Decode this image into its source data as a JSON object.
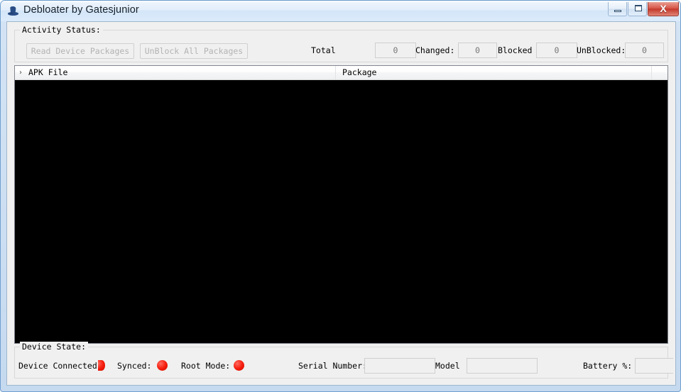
{
  "window": {
    "title": "Debloater by Gatesjunior",
    "icon": "top-hat-icon",
    "controls": {
      "minimize": "minimize-icon",
      "maximize": "maximize-icon",
      "close_label": "X"
    },
    "accent_color": "#c3392c",
    "frame_color": "#6f9fcf"
  },
  "activity": {
    "legend": "Activity Status:",
    "buttons": [
      {
        "label": "Read Device Packages",
        "enabled": false
      },
      {
        "label": "UnBlock All Packages",
        "enabled": false
      }
    ],
    "counters": [
      {
        "label": "Total",
        "value": "0"
      },
      {
        "label": "Changed:",
        "value": "0"
      },
      {
        "label": "Blocked",
        "value": "0"
      },
      {
        "label": "UnBlocked:",
        "value": "0"
      }
    ]
  },
  "list": {
    "sort_indicator": "›",
    "columns": [
      "APK File",
      "Package",
      ""
    ],
    "rows": [],
    "background_color": "#000000"
  },
  "device_state": {
    "legend": "Device State:",
    "indicators": [
      {
        "label": "Device Connected:",
        "status_color": "#f51d0d"
      },
      {
        "label": "Synced:",
        "status_color": "#f51d0d"
      },
      {
        "label": "Root Mode:",
        "status_color": "#f51d0d"
      }
    ],
    "fields": [
      {
        "label": "Serial Number:",
        "value": ""
      },
      {
        "label": "Model",
        "value": ""
      },
      {
        "label": "Battery %:",
        "value": ""
      }
    ]
  }
}
